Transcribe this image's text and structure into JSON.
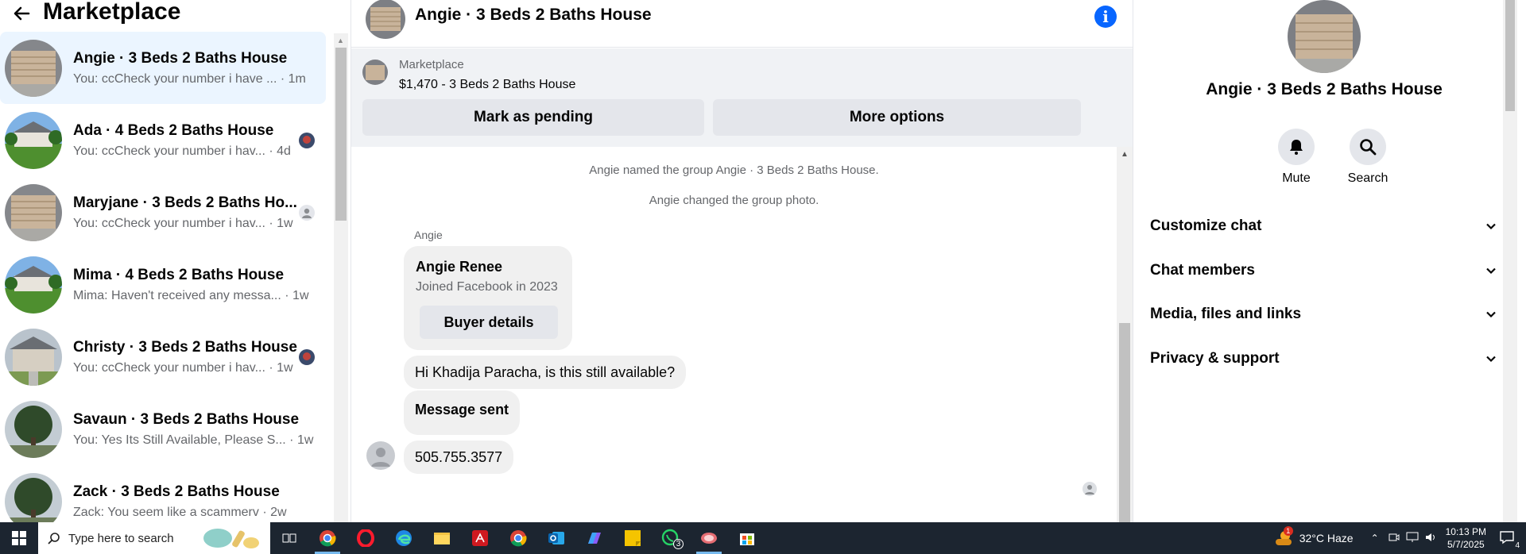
{
  "left": {
    "title": "Marketplace",
    "conversations": [
      {
        "name": "Angie · 3 Beds 2 Baths House",
        "preview": "You: ccCheck your number i have ... · 1m",
        "active": true,
        "thumb": "garage"
      },
      {
        "name": "Ada · 4 Beds 2 Baths House",
        "preview": "You: ccCheck your number i hav... · 4d",
        "active": false,
        "thumb": "lawn",
        "badge": "avatar"
      },
      {
        "name": "Maryjane · 3 Beds 2 Baths Ho...",
        "preview": "You: ccCheck your number i hav... · 1w",
        "active": false,
        "thumb": "garage",
        "badge": "default"
      },
      {
        "name": "Mima · 4 Beds 2 Baths House",
        "preview": "Mima: Haven't received any messa... · 1w",
        "active": false,
        "thumb": "lawn"
      },
      {
        "name": "Christy · 3 Beds 2 Baths House",
        "preview": "You: ccCheck your number i hav... · 1w",
        "active": false,
        "thumb": "house",
        "badge": "avatar"
      },
      {
        "name": "Savaun · 3 Beds 2 Baths House",
        "preview": "You: Yes Its Still Available, Please S... · 1w",
        "active": false,
        "thumb": "tree"
      },
      {
        "name": "Zack · 3 Beds 2 Baths House",
        "preview": "Zack: You seem like a scammerv · 2w",
        "active": false,
        "thumb": "tree"
      }
    ]
  },
  "chat": {
    "title": "Angie · 3 Beds 2 Baths House",
    "marketplace_label": "Marketplace",
    "listing": "$1,470 - 3 Beds 2 Baths House",
    "mark_pending": "Mark as pending",
    "more_options": "More options",
    "system_messages": [
      "Angie named the group Angie · 3 Beds 2 Baths House.",
      "Angie changed the group photo."
    ],
    "sender": "Angie",
    "buyer_card": {
      "name": "Angie Renee",
      "joined": "Joined Facebook in 2023",
      "button": "Buyer details"
    },
    "messages": [
      "Hi Khadija Paracha, is this still available?",
      "Message sent",
      "505.755.3577"
    ]
  },
  "right": {
    "title": "Angie · 3 Beds 2 Baths House",
    "actions": [
      {
        "label": "Mute",
        "icon": "bell-icon"
      },
      {
        "label": "Search",
        "icon": "search-icon"
      }
    ],
    "sections": [
      "Customize chat",
      "Chat members",
      "Media, files and links",
      "Privacy & support"
    ]
  },
  "taskbar": {
    "search_placeholder": "Type here to search",
    "weather": "32°C  Haze",
    "time": "10:13 PM",
    "date": "5/7/2025",
    "notification_count": "4",
    "whatsapp_badge": "3",
    "weather_badge": "1"
  }
}
